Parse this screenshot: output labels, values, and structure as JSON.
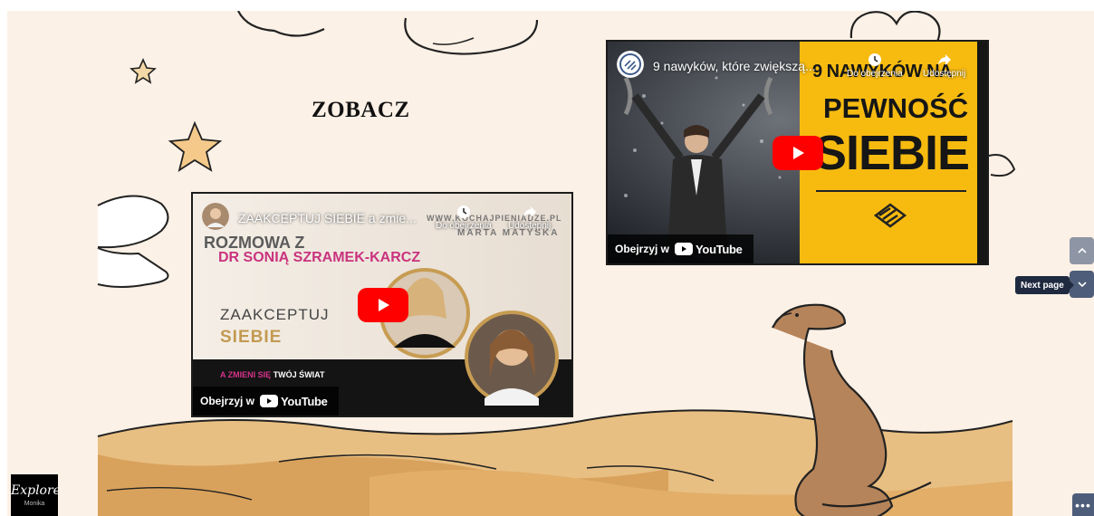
{
  "heading": "ZOBACZ",
  "videos": [
    {
      "title": "ZAAKCEPTUJ SIEBIE a zmie...",
      "watch_later": "Do obejrzenia",
      "share": "Udostępnij",
      "watch_on": "Obejrzyj w",
      "youtube": "YouTube",
      "thumbnail": {
        "website": "WWW.KOCHAJPIENIADZE.PL",
        "conversation_with": "ROZMOWA Z",
        "guest": "DR SONIĄ SZRAMEK-KARCZ",
        "host": "MARTA MATYSKA",
        "line1": "ZAAKCEPTUJ",
        "line2": "SIEBIE",
        "line3_pink": "A ZMIENI SIĘ",
        "line3_white": "TWÓJ ŚWIAT"
      }
    },
    {
      "title": "9 nawyków, które zwiększą...",
      "watch_later": "Do obejrzenia",
      "share": "Udostępnij",
      "watch_on": "Obejrzyj w",
      "youtube": "YouTube",
      "thumbnail": {
        "line1": "9 NAWYKÓW NA",
        "line2": "PEWNOŚĆ",
        "line3": "SIEBIE"
      }
    }
  ],
  "navigation": {
    "next_page_tooltip": "Next page",
    "prev_icon": "chevron-up-icon",
    "next_icon": "chevron-down-icon",
    "more_icon": "more-icon"
  },
  "site_badge": {
    "script": "Explore",
    "name": "Monika"
  },
  "colors": {
    "background": "#fcf1e6",
    "youtube_red": "#ff0000",
    "yellow": "#f7bb10",
    "pink": "#d4338b",
    "nav_button": "#4e5d79"
  }
}
